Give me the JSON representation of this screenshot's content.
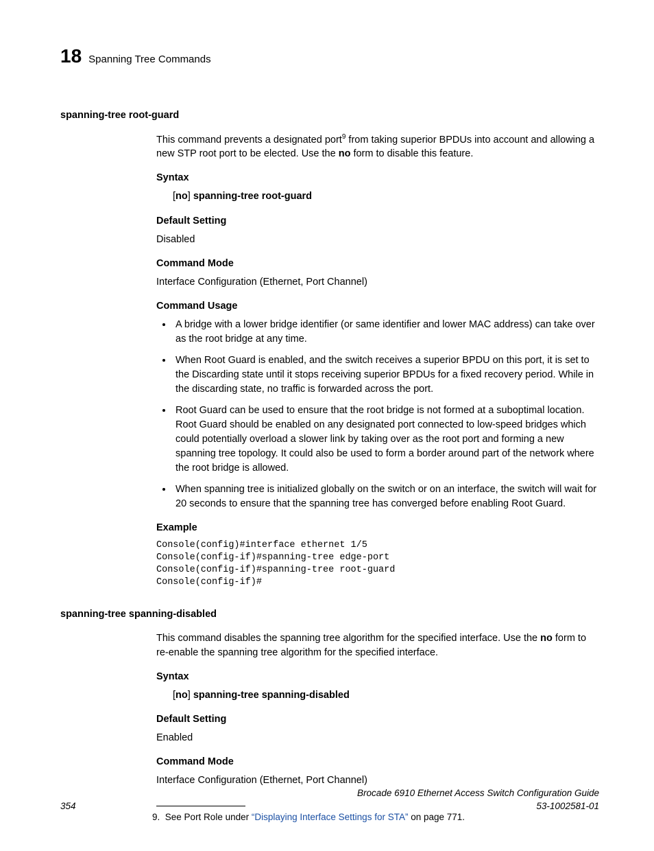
{
  "header": {
    "chapter_num": "18",
    "chapter_title": "Spanning Tree Commands"
  },
  "section1": {
    "name": "spanning-tree root-guard",
    "intro_a": "This command prevents a designated port",
    "intro_sup": "9",
    "intro_b": " from taking superior BPDUs into account and allowing a new STP root port to be elected. Use the ",
    "intro_no": "no",
    "intro_c": " form to disable this feature.",
    "syntax_head": "Syntax",
    "syntax_prefix": "[",
    "syntax_no": "no",
    "syntax_mid": "] ",
    "syntax_cmd": "spanning-tree root-guard",
    "default_head": "Default Setting",
    "default_val": "Disabled",
    "mode_head": "Command Mode",
    "mode_val": "Interface Configuration (Ethernet, Port Channel)",
    "usage_head": "Command Usage",
    "usage_items": [
      "A bridge with a lower bridge identifier (or same identifier and lower MAC address) can take over as the root bridge at any time.",
      "When Root Guard is enabled, and the switch receives a superior BPDU on this port, it is set to the Discarding state until it stops receiving superior BPDUs for a fixed recovery period. While in the discarding state, no traffic is forwarded across the port.",
      "Root Guard can be used to ensure that the root bridge is not formed at a suboptimal location. Root Guard should be enabled on any designated port connected to low-speed bridges which could potentially overload a slower link by taking over as the root port and forming a new spanning tree topology. It could also be used to form a border around part of the network where the root bridge is allowed.",
      "When spanning tree is initialized globally on the switch or on an interface, the switch will wait for 20 seconds to ensure that the spanning tree has converged before enabling Root Guard."
    ],
    "example_head": "Example",
    "example_code": "Console(config)#interface ethernet 1/5\nConsole(config-if)#spanning-tree edge-port\nConsole(config-if)#spanning-tree root-guard\nConsole(config-if)#"
  },
  "section2": {
    "name": "spanning-tree spanning-disabled",
    "intro_a": "This command disables the spanning tree algorithm for the specified interface. Use the ",
    "intro_no": "no",
    "intro_b": " form to re-enable the spanning tree algorithm for the specified interface.",
    "syntax_head": "Syntax",
    "syntax_prefix": "[",
    "syntax_no": "no",
    "syntax_mid": "] ",
    "syntax_cmd": "spanning-tree spanning-disabled",
    "default_head": "Default Setting",
    "default_val": "Enabled",
    "mode_head": "Command Mode",
    "mode_val": "Interface Configuration (Ethernet, Port Channel)"
  },
  "footnote": {
    "num": "9.",
    "pre": "See Port Role under ",
    "link": "“Displaying Interface Settings for STA”",
    "post": " on page 771."
  },
  "footer": {
    "page_num": "354",
    "title": "Brocade 6910 Ethernet Access Switch Configuration Guide",
    "docnum": "53-1002581-01"
  }
}
